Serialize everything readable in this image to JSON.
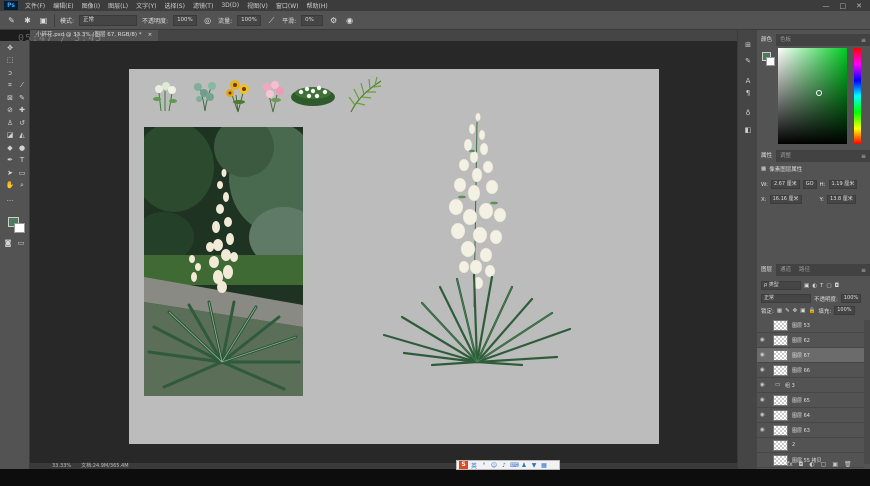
{
  "menubar": {
    "logo": "Ps",
    "items": [
      "文件(F)",
      "编辑(E)",
      "图像(I)",
      "图层(L)",
      "文字(Y)",
      "选择(S)",
      "滤镜(T)",
      "3D(D)",
      "视图(V)",
      "窗口(W)",
      "帮助(H)"
    ],
    "controls": [
      "—",
      "□",
      "✕"
    ]
  },
  "options": {
    "mode_label": "模式:",
    "mode_value": "正常",
    "opacity_label": "不透明度:",
    "opacity_value": "100%",
    "flow_label": "流量:",
    "flow_value": "100%",
    "smooth_label": "平滑:",
    "smooth_value": "0%"
  },
  "document": {
    "tab_title": "小碎花.psd @ 33.3% (图层 67, RGB/8) *",
    "tab_close": "×",
    "watermark": "05:47 / 5:45"
  },
  "panels": {
    "color_tabs": [
      "颜色",
      "色板"
    ],
    "properties_tabs": [
      "属性",
      "调整"
    ],
    "properties_title": "像素图层属性",
    "w_label": "W:",
    "w_value": "2.67 厘米",
    "go_label": "GO",
    "h_label": "H:",
    "h_value": "1.19 厘米",
    "x_label": "X:",
    "x_value": "16.16 厘米",
    "y_label": "Y:",
    "y_value": "13.8 厘米",
    "layers_tabs": [
      "图层",
      "通道",
      "路径"
    ],
    "kind_label": "ρ 类型",
    "blend_value": "正常",
    "opacity_label": "不透明度:",
    "opacity_value": "100%",
    "lock_label": "锁定:",
    "fill_label": "填充:",
    "fill_value": "100%",
    "layers": [
      {
        "name": "图层 53",
        "visible": false,
        "selected": false,
        "thumb": true
      },
      {
        "name": "图层 62",
        "visible": true,
        "selected": false,
        "thumb": true
      },
      {
        "name": "图层 67",
        "visible": true,
        "selected": true,
        "thumb": true
      },
      {
        "name": "图层 66",
        "visible": true,
        "selected": false,
        "thumb": true
      },
      {
        "name": "组 3",
        "visible": true,
        "selected": false,
        "thumb": false
      },
      {
        "name": "图层 65",
        "visible": true,
        "selected": false,
        "thumb": true
      },
      {
        "name": "图层 64",
        "visible": true,
        "selected": false,
        "thumb": true
      },
      {
        "name": "图层 63",
        "visible": true,
        "selected": false,
        "thumb": true
      },
      {
        "name": "2",
        "visible": false,
        "selected": false,
        "thumb": true
      },
      {
        "name": "图层 55 拷贝",
        "visible": false,
        "selected": false,
        "thumb": true
      }
    ],
    "footer_icons": [
      "fx",
      "◘",
      "◐",
      "▢",
      "▣",
      "🗑"
    ]
  },
  "status": {
    "zoom": "33.33%",
    "doc_info": "文档:24.9M/365.4M"
  },
  "ime": {
    "logo": "S",
    "label": "英"
  },
  "colors": {
    "foreground": "#4c7a5f",
    "background": "#ffffff"
  }
}
